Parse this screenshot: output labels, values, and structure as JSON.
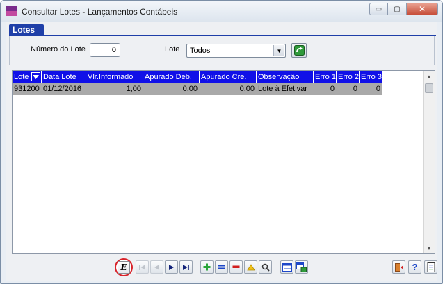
{
  "window": {
    "title": "Consultar Lotes - Lançamentos Contábeis",
    "controls": {
      "minimize": "▭",
      "maximize": "▢",
      "close": "✕"
    }
  },
  "tabs": [
    {
      "label": "Lotes"
    }
  ],
  "filters": {
    "numero_lote_label": "Número do Lote",
    "numero_lote_value": "0",
    "lote_label": "Lote",
    "lote_selected": "Todos"
  },
  "grid": {
    "columns": [
      "Lote",
      "Data Lote",
      "Vlr.Informado",
      "Apurado Deb.",
      "Apurado Cre.",
      "Observação",
      "Erro 1",
      "Erro 2",
      "Erro 3"
    ],
    "rows": [
      [
        "931200",
        "01/12/2016",
        "1,00",
        "0,00",
        "0,00",
        "Lote à Efetivar",
        "0",
        "0",
        "0"
      ]
    ]
  },
  "toolbar": {
    "e_button": "E",
    "icons": [
      "first-icon",
      "prior-icon",
      "next-icon",
      "last-icon",
      "insert-icon",
      "post-icon",
      "delete-icon",
      "edit-icon",
      "search-icon",
      "list-icon",
      "export-icon",
      "exit-icon",
      "help-icon",
      "print-icon"
    ],
    "help_glyph": "?"
  },
  "colors": {
    "header": "#1010e8",
    "tab": "#1f3fa8",
    "row": "#a9a9a9",
    "accent_red": "#d8232a"
  }
}
